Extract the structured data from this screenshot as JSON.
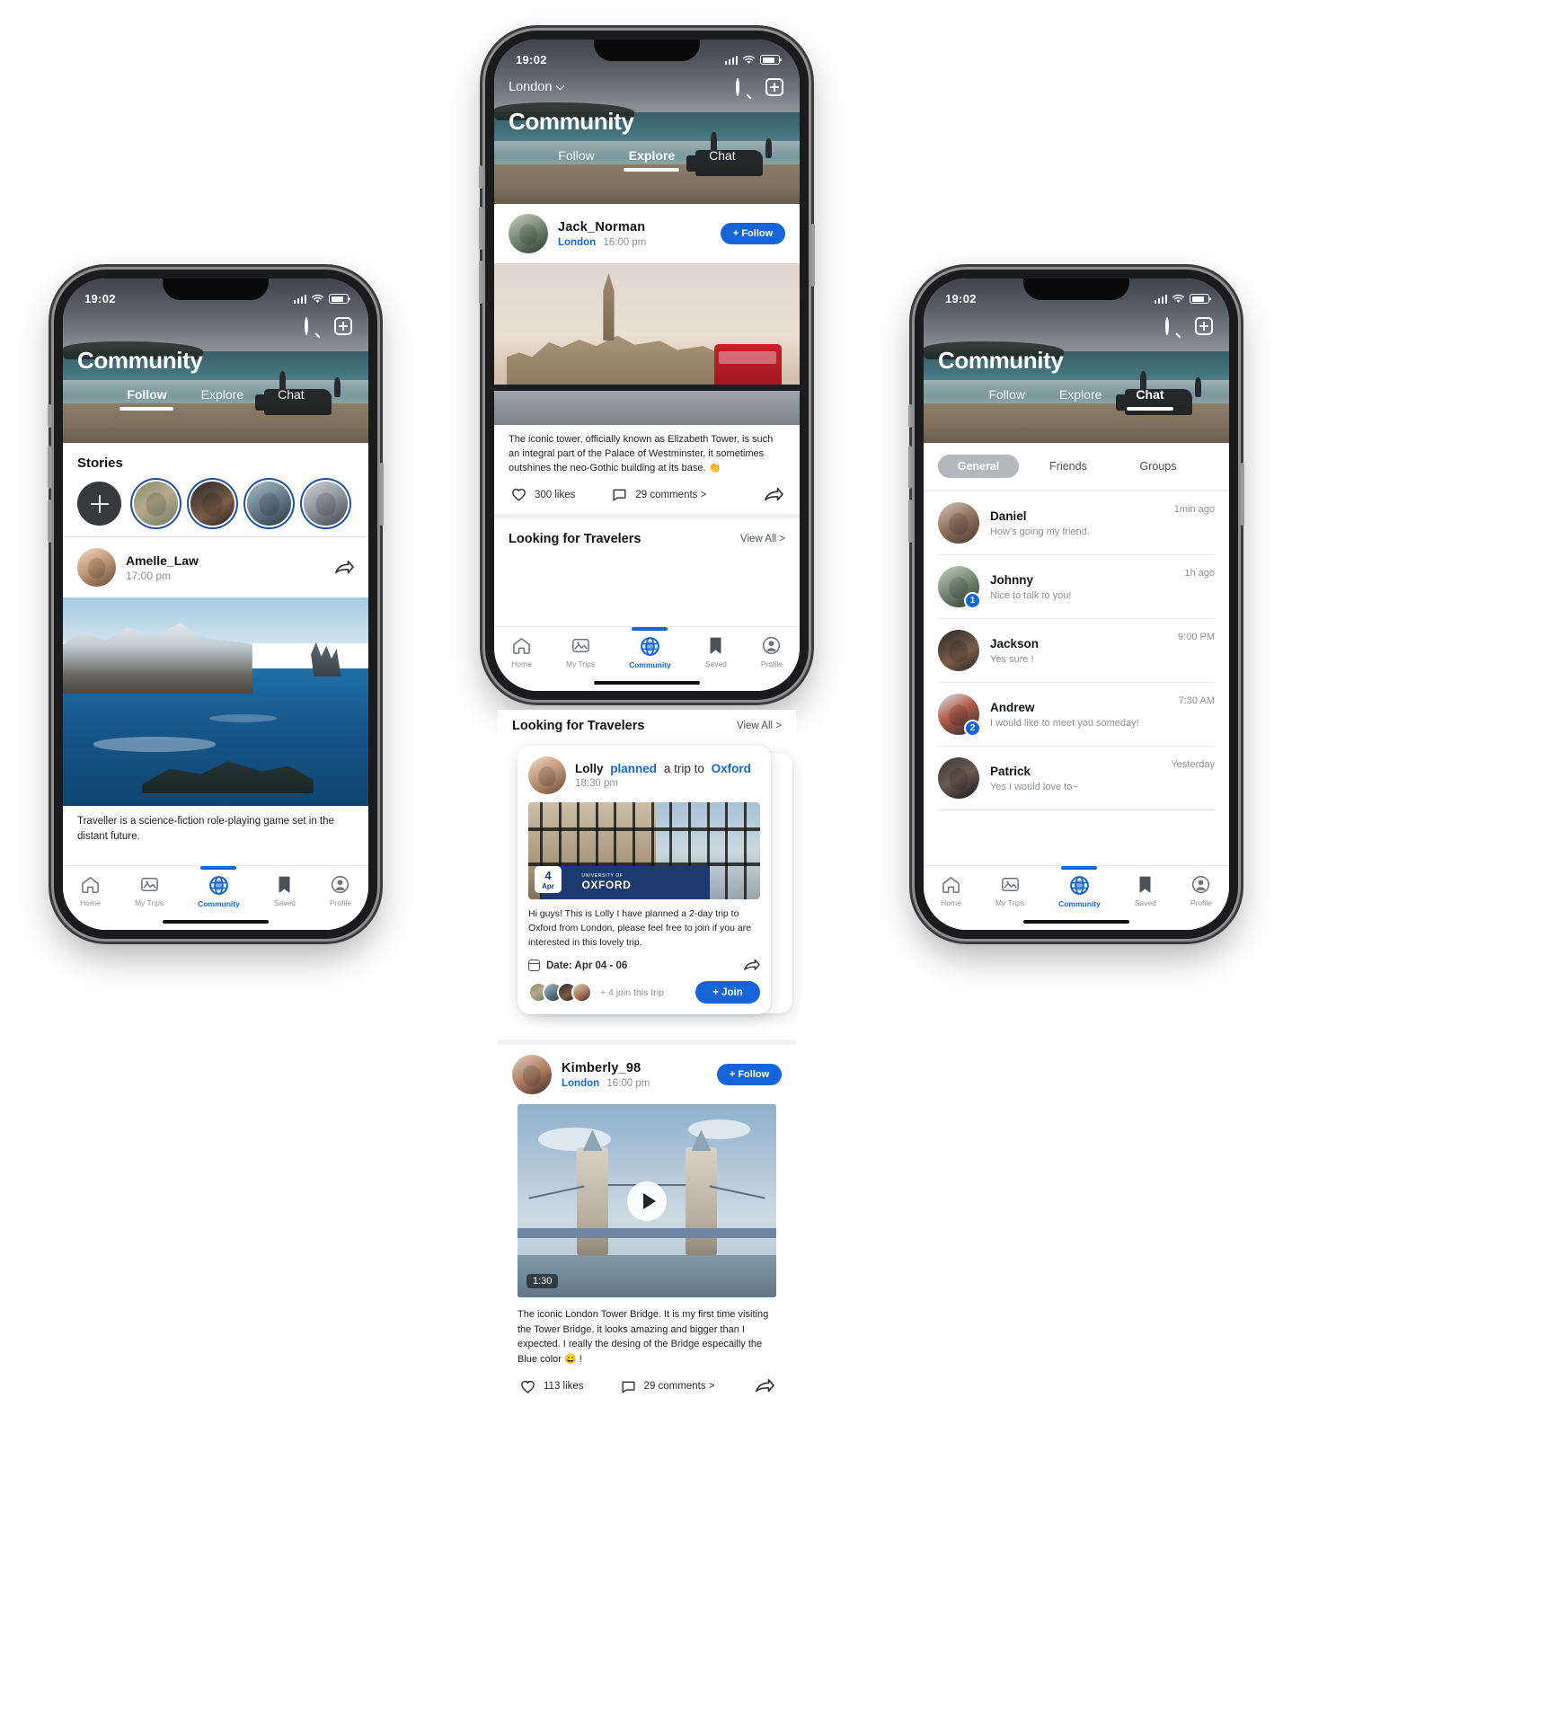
{
  "status_bar": {
    "time": "19:02"
  },
  "header": {
    "location": "London",
    "title": "Community",
    "search_icon": "search-icon",
    "add_icon": "plus-square-icon",
    "chevron_icon": "chevron-down-icon"
  },
  "tabs": [
    {
      "label": "Follow"
    },
    {
      "label": "Explore"
    },
    {
      "label": "Chat"
    }
  ],
  "bottom_nav": [
    {
      "label": "Home",
      "icon": "home-icon"
    },
    {
      "label": "My Trips",
      "icon": "image-icon"
    },
    {
      "label": "Community",
      "icon": "globe-icon"
    },
    {
      "label": "Saved",
      "icon": "bookmark-icon"
    },
    {
      "label": "Profile",
      "icon": "person-circle-icon"
    }
  ],
  "phone_left": {
    "active_tab": "Follow",
    "stories": {
      "title": "Stories",
      "add_label": "+",
      "items": [
        "story-1",
        "story-2",
        "story-3",
        "story-4"
      ]
    },
    "post": {
      "username": "Amelle_Law",
      "time": "17:00 pm",
      "share_icon": "share-icon",
      "caption": "Traveller is a science-fiction role-playing game set in the distant future."
    }
  },
  "phone_center": {
    "active_tab": "Explore",
    "post_1": {
      "username": "Jack_Norman",
      "location": "London",
      "time": "16:00 pm",
      "follow_label": "+ Follow",
      "caption": "The iconic tower, officially known as Elizabeth Tower, is such an integral part of the Palace of Westminster, it sometimes outshines the neo-Gothic building at its base. 👏",
      "likes": "300 likes",
      "comments": "29 comments >",
      "like_icon": "heart-icon",
      "comment_icon": "comment-bubble-icon",
      "share_icon": "share-icon"
    },
    "looking_section": {
      "title": "Looking for Travelers",
      "view_all": "View All >"
    },
    "trip_card": {
      "username": "Lolly",
      "action": "planned",
      "mid": "a trip to",
      "destination": "Oxford",
      "time": "18:30 pm",
      "image_badge_day": "4",
      "image_badge_month": "Apr",
      "image_sign": "OXFORD",
      "image_sign_sub": "UNIVERSITY OF",
      "body": "Hi guys! This is Lolly I have planned a 2-day trip to Oxford from London, please feel free to join if you are interested in this lovely trip.",
      "date_label": "Date: Apr 04 - 06",
      "date_icon": "calendar-icon",
      "share_icon": "share-icon",
      "join_count": "+ 4 join this trip",
      "join_label": "+ Join"
    },
    "post_2": {
      "username": "Kimberly_98",
      "location": "London",
      "time": "16:00 pm",
      "follow_label": "+ Follow",
      "video_duration": "1:30",
      "play_icon": "play-icon",
      "caption": "The iconic London Tower Bridge. It is my first time visiting the Tower Bridge, it looks amazing and bigger than I expected. I really the desing of the Bridge especailly the Blue color 😄 !",
      "likes": "113 likes",
      "comments": "29 comments >",
      "like_icon": "heart-icon",
      "comment_icon": "comment-bubble-icon",
      "share_icon": "share-icon"
    }
  },
  "phone_right": {
    "active_tab": "Chat",
    "segments": [
      {
        "label": "General",
        "selected": true
      },
      {
        "label": "Friends",
        "selected": false
      },
      {
        "label": "Groups",
        "selected": false
      }
    ],
    "chats": [
      {
        "name": "Daniel",
        "message": "How's going my friend.",
        "time": "1min ago",
        "badge": ""
      },
      {
        "name": "Johnny",
        "message": "Nice to talk to you!",
        "time": "1h ago",
        "badge": "1"
      },
      {
        "name": "Jackson",
        "message": "Yes sure !",
        "time": "9:00 PM",
        "badge": ""
      },
      {
        "name": "Andrew",
        "message": "I would like to meet you someday!",
        "time": "7:30 AM",
        "badge": "2"
      },
      {
        "name": "Patrick",
        "message": "Yes I would love to~",
        "time": "Yesterday",
        "badge": ""
      }
    ]
  },
  "colors": {
    "accent": "#1565d8",
    "muted": "#8b9099",
    "text": "#111317",
    "divider": "#e9eaec"
  }
}
